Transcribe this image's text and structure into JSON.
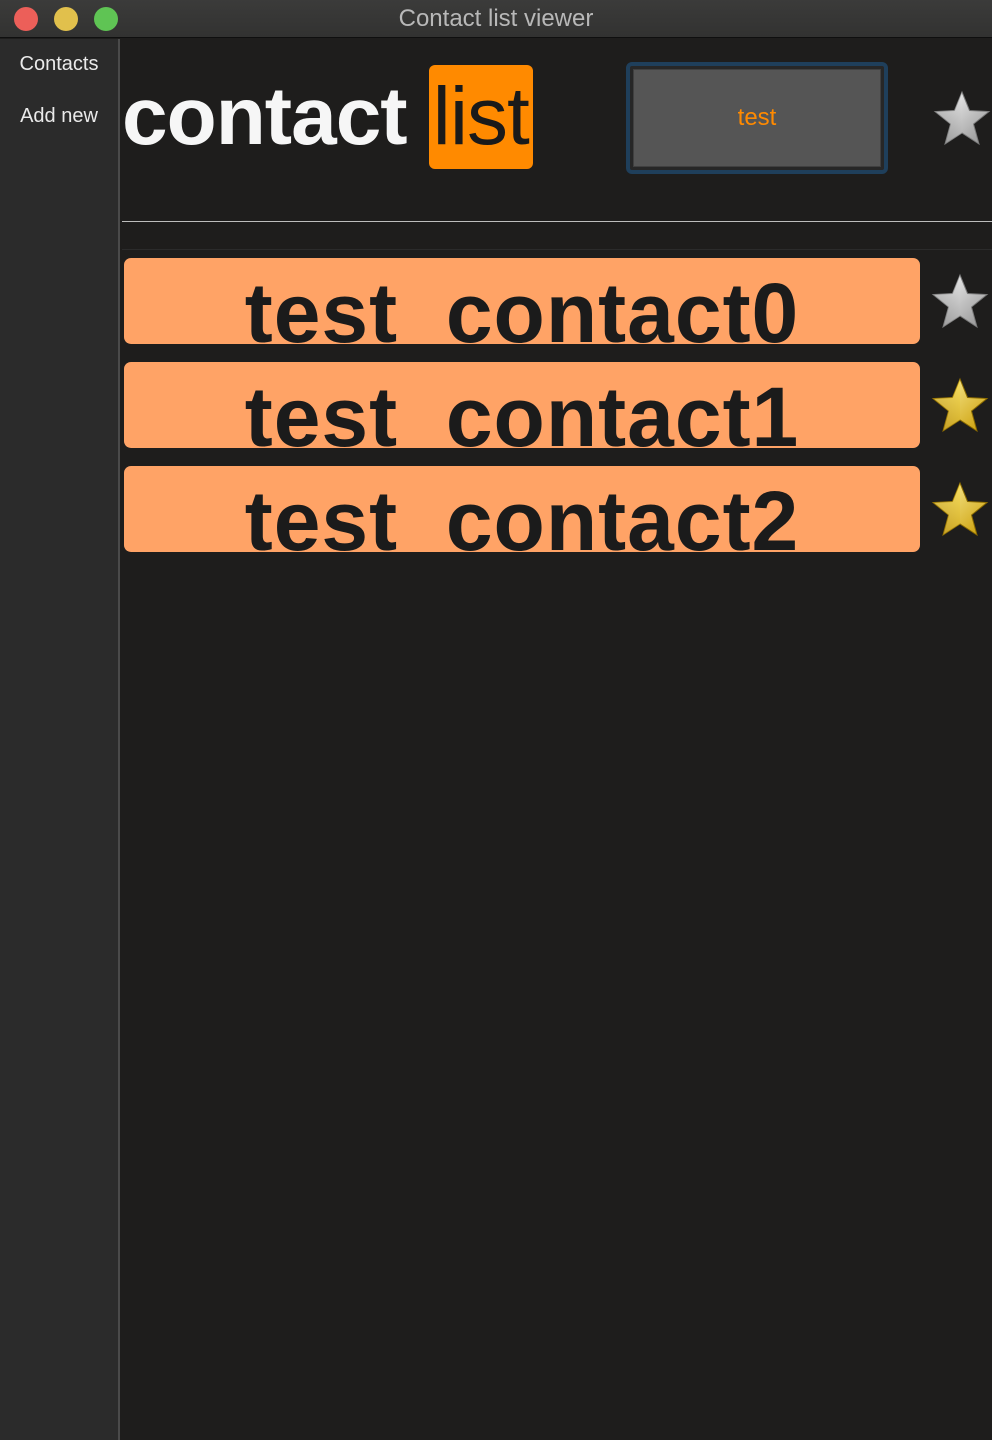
{
  "window": {
    "title": "Contact list viewer"
  },
  "sidebar": {
    "items": [
      {
        "label": "Contacts"
      },
      {
        "label": "Add new"
      }
    ]
  },
  "header": {
    "title_word": "contact",
    "title_highlight": "list",
    "test_button_label": "test",
    "favorite_star": "silver-star-icon"
  },
  "contacts": [
    {
      "name": "test_contact0",
      "favorite": false,
      "star_icon": "silver-star-icon"
    },
    {
      "name": "test_contact1",
      "favorite": true,
      "star_icon": "gold-star-icon"
    },
    {
      "name": "test_contact2",
      "favorite": true,
      "star_icon": "gold-star-icon"
    }
  ],
  "colors": {
    "accent": "#ff8a00",
    "row_background": "#ffa366",
    "background": "#1e1d1c",
    "sidebar": "#2b2b2b"
  }
}
